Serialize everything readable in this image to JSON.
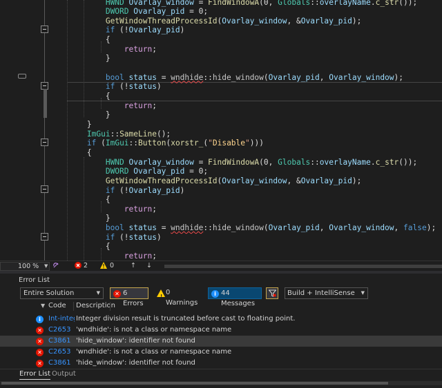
{
  "editor": {
    "lines": [
      [
        [
          "",
          "            "
        ],
        [
          "ty",
          "HWND"
        ],
        [
          "",
          " "
        ],
        [
          "vr",
          "Ovarlay_window"
        ],
        [
          "",
          " = "
        ],
        [
          "fn",
          "FindWindowA"
        ],
        [
          "",
          "("
        ],
        [
          "",
          "0"
        ],
        [
          "",
          ", "
        ],
        [
          "ty",
          "Globals"
        ],
        [
          "",
          "::"
        ],
        [
          "vr",
          "overlayName"
        ],
        [
          "",
          "."
        ],
        [
          "fn",
          "c_str"
        ],
        [
          "",
          "());"
        ]
      ],
      [
        [
          "",
          "            "
        ],
        [
          "ty",
          "DWORD"
        ],
        [
          "",
          " "
        ],
        [
          "vr",
          "Ovarlay_pid"
        ],
        [
          "",
          " = "
        ],
        [
          "",
          "0"
        ],
        [
          "",
          ";"
        ]
      ],
      [
        [
          "",
          "            "
        ],
        [
          "fn",
          "GetWindowThreadProcessId"
        ],
        [
          "",
          "("
        ],
        [
          "vr",
          "Ovarlay_window"
        ],
        [
          "",
          ", &"
        ],
        [
          "vr",
          "Ovarlay_pid"
        ],
        [
          "",
          ");"
        ]
      ],
      [
        [
          "",
          "            "
        ],
        [
          "kw",
          "if"
        ],
        [
          "",
          " (!"
        ],
        [
          "vr",
          "Ovarlay_pid"
        ],
        [
          "",
          ")"
        ]
      ],
      [
        [
          "",
          "            "
        ],
        [
          "",
          "{"
        ]
      ],
      [
        [
          "",
          "                "
        ],
        [
          "rt",
          "return"
        ],
        [
          "",
          ";"
        ]
      ],
      [
        [
          "",
          "            "
        ],
        [
          "",
          "}"
        ]
      ],
      [
        [
          "",
          ""
        ]
      ],
      [
        [
          "",
          "            "
        ],
        [
          "kw",
          "bool"
        ],
        [
          "",
          " "
        ],
        [
          "vr",
          "status"
        ],
        [
          "",
          " = "
        ],
        [
          "wv",
          "wndhide"
        ],
        [
          "",
          "::"
        ],
        [
          "pr",
          "hide_window"
        ],
        [
          "",
          "("
        ],
        [
          "vr",
          "Ovarlay_pid"
        ],
        [
          "",
          ", "
        ],
        [
          "vr",
          "Ovarlay_window"
        ],
        [
          "",
          ");"
        ]
      ],
      [
        [
          "",
          "            "
        ],
        [
          "kw",
          "if"
        ],
        [
          "",
          " (!"
        ],
        [
          "vr",
          "status"
        ],
        [
          "",
          ")"
        ]
      ],
      [
        [
          "",
          "            "
        ],
        [
          "",
          "{"
        ]
      ],
      [
        [
          "",
          "                "
        ],
        [
          "rt",
          "return"
        ],
        [
          "",
          ";"
        ]
      ],
      [
        [
          "",
          "            "
        ],
        [
          "",
          "}"
        ]
      ],
      [
        [
          "",
          "        "
        ],
        [
          "",
          "}"
        ]
      ],
      [
        [
          "",
          "        "
        ],
        [
          "ty",
          "ImGui"
        ],
        [
          "",
          "::"
        ],
        [
          "fn",
          "SameLine"
        ],
        [
          "",
          "();"
        ]
      ],
      [
        [
          "",
          "        "
        ],
        [
          "kw",
          "if"
        ],
        [
          "",
          " ("
        ],
        [
          "ty",
          "ImGui"
        ],
        [
          "",
          "::"
        ],
        [
          "fn",
          "Button"
        ],
        [
          "",
          "("
        ],
        [
          "fn",
          "xorstr_"
        ],
        [
          "",
          "("
        ],
        [
          "st",
          "\""
        ],
        [
          "es",
          "Disable"
        ],
        [
          "st",
          "\""
        ],
        [
          "",
          ")))"
        ]
      ],
      [
        [
          "",
          "        "
        ],
        [
          "",
          "{"
        ]
      ],
      [
        [
          "",
          "            "
        ],
        [
          "ty",
          "HWND"
        ],
        [
          "",
          " "
        ],
        [
          "vr",
          "Ovarlay_window"
        ],
        [
          "",
          " = "
        ],
        [
          "fn",
          "FindWindowA"
        ],
        [
          "",
          "("
        ],
        [
          "",
          "0"
        ],
        [
          "",
          ", "
        ],
        [
          "ty",
          "Globals"
        ],
        [
          "",
          "::"
        ],
        [
          "vr",
          "overlayName"
        ],
        [
          "",
          "."
        ],
        [
          "fn",
          "c_str"
        ],
        [
          "",
          "());"
        ]
      ],
      [
        [
          "",
          "            "
        ],
        [
          "ty",
          "DWORD"
        ],
        [
          "",
          " "
        ],
        [
          "vr",
          "Ovarlay_pid"
        ],
        [
          "",
          " = "
        ],
        [
          "",
          "0"
        ],
        [
          "",
          ";"
        ]
      ],
      [
        [
          "",
          "            "
        ],
        [
          "fn",
          "GetWindowThreadProcessId"
        ],
        [
          "",
          "("
        ],
        [
          "vr",
          "Ovarlay_window"
        ],
        [
          "",
          ", &"
        ],
        [
          "vr",
          "Ovarlay_pid"
        ],
        [
          "",
          ");"
        ]
      ],
      [
        [
          "",
          "            "
        ],
        [
          "kw",
          "if"
        ],
        [
          "",
          " (!"
        ],
        [
          "vr",
          "Ovarlay_pid"
        ],
        [
          "",
          ")"
        ]
      ],
      [
        [
          "",
          "            "
        ],
        [
          "",
          "{"
        ]
      ],
      [
        [
          "",
          "                "
        ],
        [
          "rt",
          "return"
        ],
        [
          "",
          ";"
        ]
      ],
      [
        [
          "",
          "            "
        ],
        [
          "",
          "}"
        ]
      ],
      [
        [
          "",
          "            "
        ],
        [
          "kw",
          "bool"
        ],
        [
          "",
          " "
        ],
        [
          "vr",
          "status"
        ],
        [
          "",
          " = "
        ],
        [
          "wv",
          "wndhide"
        ],
        [
          "",
          "::"
        ],
        [
          "pr",
          "hide_window"
        ],
        [
          "",
          "("
        ],
        [
          "vr",
          "Ovarlay_pid"
        ],
        [
          "",
          ", "
        ],
        [
          "vr",
          "Ovarlay_window"
        ],
        [
          "",
          ", "
        ],
        [
          "kw",
          "false"
        ],
        [
          "",
          ");"
        ]
      ],
      [
        [
          "",
          "            "
        ],
        [
          "kw",
          "if"
        ],
        [
          "",
          " (!"
        ],
        [
          "vr",
          "status"
        ],
        [
          "",
          ")"
        ]
      ],
      [
        [
          "",
          "            "
        ],
        [
          "",
          "{"
        ]
      ],
      [
        [
          "",
          "                "
        ],
        [
          "rt",
          "return"
        ],
        [
          "",
          ";"
        ]
      ]
    ]
  },
  "status_bar": {
    "zoom": "100 %",
    "errors": "2",
    "warnings": "0"
  },
  "error_list": {
    "title": "Error List",
    "scope": "Entire Solution",
    "errors_label": "6 Errors",
    "warnings_label": "0 Warnings",
    "messages_label": "44 Messages",
    "build_filter": "Build + IntelliSense",
    "columns": {
      "code": "Code",
      "description": "Description"
    },
    "rows": [
      {
        "type": "info",
        "code": "Int-integer",
        "description": "Integer division result is truncated before cast to floating point."
      },
      {
        "type": "error",
        "code": "C2653",
        "description": "'wndhide': is not a class or namespace name"
      },
      {
        "type": "error",
        "code": "C3861",
        "description": "'hide_window': identifier not found"
      },
      {
        "type": "error",
        "code": "C2653",
        "description": "'wndhide': is not a class or namespace name"
      },
      {
        "type": "error",
        "code": "C3861",
        "description": "'hide_window': identifier not found"
      }
    ],
    "tabs": [
      "Error List",
      "Output"
    ]
  }
}
